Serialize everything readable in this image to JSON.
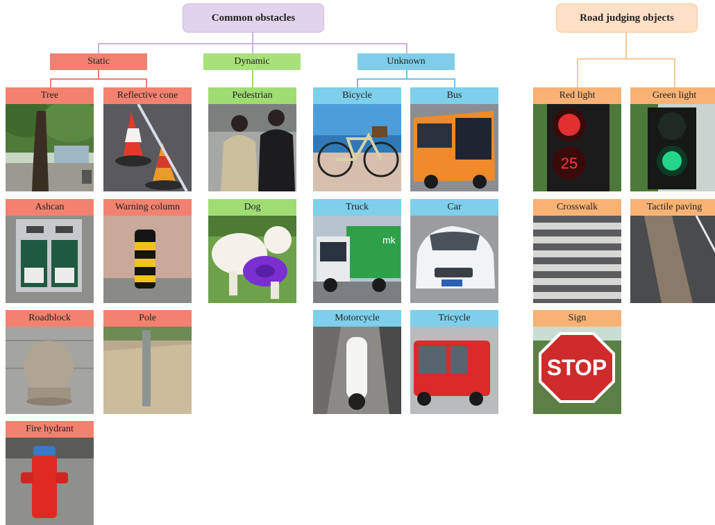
{
  "roots": {
    "common": "Common obstacles",
    "road": "Road judging objects"
  },
  "categories": {
    "static": "Static",
    "dynamic": "Dynamic",
    "unknown": "Unknown"
  },
  "tiles": {
    "tree": "Tree",
    "reflective_cone": "Reflective cone",
    "ashcan": "Ashcan",
    "warning_column": "Warning column",
    "roadblock": "Roadblock",
    "pole": "Pole",
    "fire_hydrant": "Fire hydrant",
    "pedestrian": "Pedestrian",
    "dog": "Dog",
    "bicycle": "Bicycle",
    "bus": "Bus",
    "truck": "Truck",
    "car": "Car",
    "motorcycle": "Motorcycle",
    "tricycle": "Tricycle",
    "red_light": "Red light",
    "green_light": "Green light",
    "crosswalk": "Crosswalk",
    "tactile_paving": "Tactile paving",
    "sign": "Sign"
  },
  "photo_text": {
    "truck_logo": "mk",
    "red_light_countdown": "25",
    "stop_sign": "STOP"
  },
  "colors": {
    "static": "#f08070",
    "dynamic": "#a8e07a",
    "unknown": "#7fcde8",
    "road": "#f8b274",
    "common_root": "#e2d3ec",
    "road_root": "#fde0c6"
  }
}
